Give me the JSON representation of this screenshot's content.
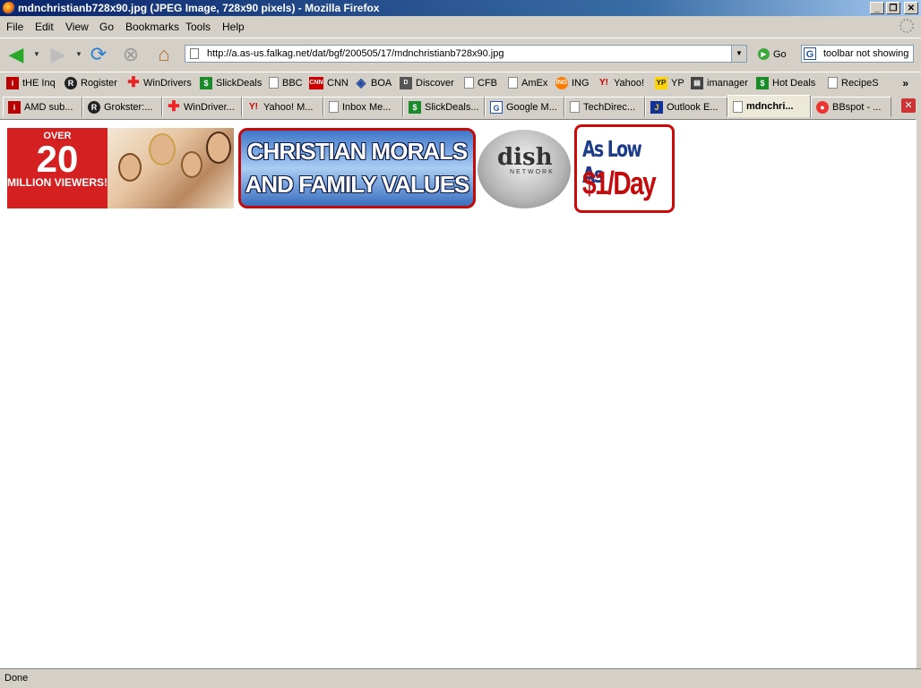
{
  "window": {
    "title": "mdnchristianb728x90.jpg (JPEG Image, 728x90 pixels) - Mozilla Firefox",
    "buttons": {
      "minimize": "_",
      "maximize": "❐",
      "close": "✕"
    }
  },
  "menu": [
    "File",
    "Edit",
    "View",
    "Go",
    "Bookmarks",
    "Tools",
    "Help"
  ],
  "nav": {
    "url": "http://a.as-us.falkag.net/dat/bgf/200505/17/mdnchristianb728x90.jpg",
    "go_label": "Go",
    "search_value": "toolbar not showing"
  },
  "bookmarks": [
    "tHE Inq",
    "Rogister",
    "WinDrivers",
    "SlickDeals",
    "BBC",
    "CNN",
    "BOA",
    "Discover",
    "CFB",
    "AmEx",
    "ING",
    "Yahoo!",
    "YP",
    "imanager",
    "Hot Deals",
    "RecipeS"
  ],
  "bookmarks_more": "»",
  "tabs": [
    "AMD sub...",
    "Grokster:...",
    "WinDriver...",
    "Yahoo! M...",
    "Inbox Me...",
    "SlickDeals...",
    "Google M...",
    "TechDirec...",
    "Outlook E...",
    "mdnchri...",
    "BBspot - ..."
  ],
  "active_tab_index": 9,
  "banner": {
    "viewers_top": "OVER",
    "viewers_number": "20",
    "viewers_bottom": "MILLION VIEWERS!",
    "morals_line1": "CHRISTIAN MORALS",
    "morals_line2": "AND FAMILY VALUES",
    "dish_logo": "dish",
    "dish_sub": "NETWORK",
    "price_line1": "As Low As",
    "price_line2": "$1/Day"
  },
  "status": {
    "text": "Done"
  },
  "colors": {
    "accent_red": "#cc0a0a",
    "titlebar": "#0a246a"
  }
}
